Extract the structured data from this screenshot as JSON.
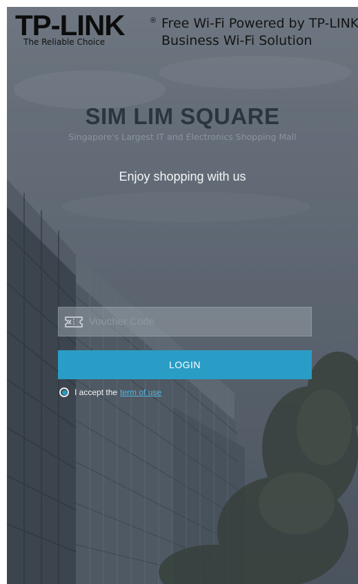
{
  "header": {
    "logo_text": "TP-LINK",
    "logo_registered": "®",
    "logo_tagline": "The Reliable Choice",
    "title_line1": "Free Wi-Fi Powered by TP-LINK",
    "title_line2": "Business Wi-Fi Solution"
  },
  "venue": {
    "name": "SIM LIM SQUARE",
    "subtitle": "Singapore's Largest IT and Electronics Shopping Mall",
    "welcome": "Enjoy shopping with us"
  },
  "form": {
    "voucher_placeholder": "Voucher Code",
    "voucher_value": "",
    "voucher_icon": "ticket-icon",
    "login_label": "LOGIN",
    "terms_prefix": "I accept the",
    "terms_link": "term of use",
    "terms_accepted": true
  },
  "colors": {
    "accent": "#2a9dc6",
    "link": "#52b7e2"
  }
}
